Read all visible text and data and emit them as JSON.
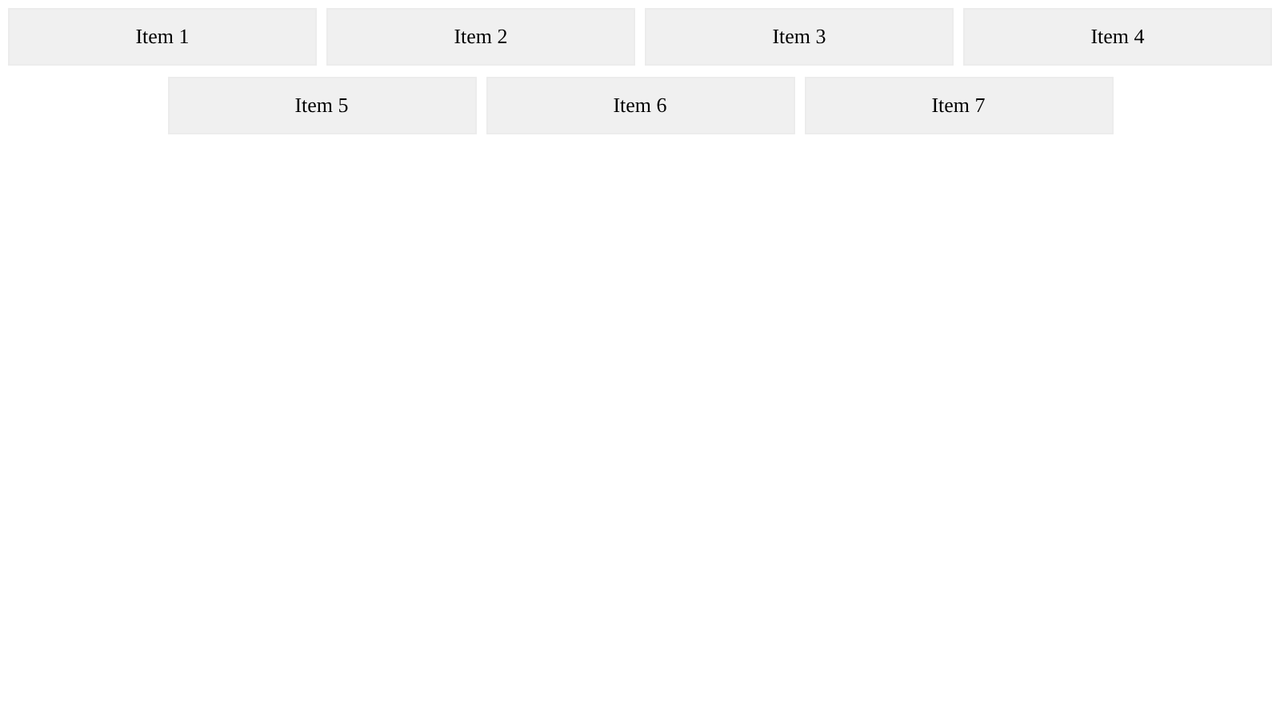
{
  "items": [
    {
      "label": "Item 1"
    },
    {
      "label": "Item 2"
    },
    {
      "label": "Item 3"
    },
    {
      "label": "Item 4"
    },
    {
      "label": "Item 5"
    },
    {
      "label": "Item 6"
    },
    {
      "label": "Item 7"
    }
  ]
}
